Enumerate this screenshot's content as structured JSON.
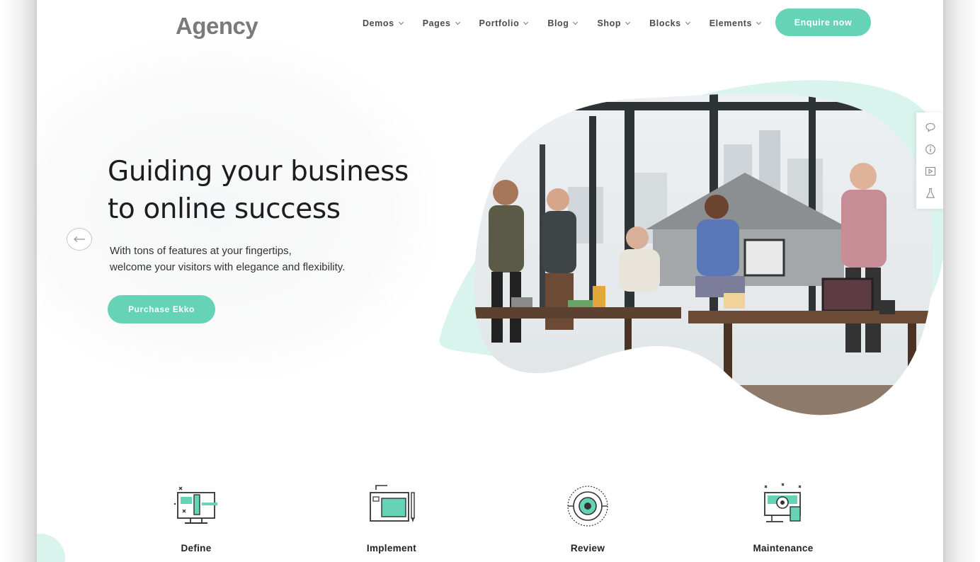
{
  "header": {
    "logo": "Agency",
    "nav": [
      {
        "label": "Demos"
      },
      {
        "label": "Pages"
      },
      {
        "label": "Portfolio"
      },
      {
        "label": "Blog"
      },
      {
        "label": "Shop"
      },
      {
        "label": "Blocks"
      },
      {
        "label": "Elements"
      }
    ],
    "cta_label": "Enquire now"
  },
  "hero": {
    "title_line1": "Guiding your business",
    "title_line2": "to online success",
    "subtitle_line1": "With tons of features at your fingertips,",
    "subtitle_line2": "welcome your visitors with elegance and flexibility.",
    "button_label": "Purchase Ekko"
  },
  "side_panel": {
    "icons": [
      "chat-icon",
      "info-icon",
      "play-icon",
      "flask-icon"
    ]
  },
  "features": [
    {
      "label": "Define",
      "icon": "monitor-wireframe-icon"
    },
    {
      "label": "Implement",
      "icon": "tablet-pencil-icon"
    },
    {
      "label": "Review",
      "icon": "eye-target-icon"
    },
    {
      "label": "Maintenance",
      "icon": "devices-gear-icon"
    }
  ],
  "colors": {
    "accent": "#66d2b6",
    "accent_light": "#d9f4ec",
    "text_dark": "#1d1d1f",
    "logo_gray": "#7a7a7a"
  }
}
